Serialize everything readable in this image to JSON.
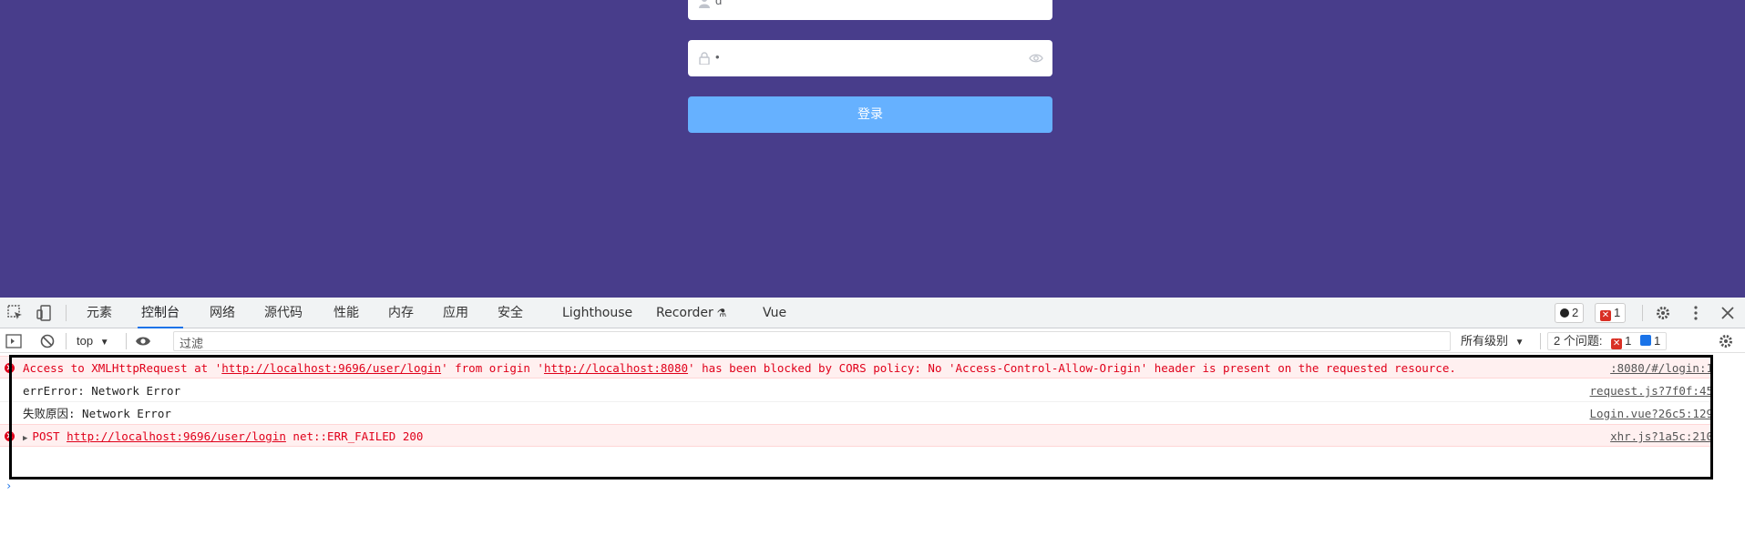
{
  "login": {
    "username_value": "d",
    "password_value": "•",
    "login_button": "登录"
  },
  "devtools": {
    "tabs": [
      {
        "label": "元素"
      },
      {
        "label": "控制台",
        "active": true
      },
      {
        "label": "网络"
      },
      {
        "label": "源代码"
      },
      {
        "label": "性能"
      },
      {
        "label": "内存"
      },
      {
        "label": "应用"
      },
      {
        "label": "安全"
      },
      {
        "label": "Lighthouse"
      },
      {
        "label": "Recorder"
      },
      {
        "label": "Vue"
      }
    ],
    "badges": {
      "messages": "2",
      "errors": "1"
    },
    "filterbar": {
      "context": "top",
      "filter_placeholder": "过滤",
      "levels": "所有级别",
      "issues_label": "2 个问题:",
      "issues_errors": "1",
      "issues_info": "1"
    },
    "console": [
      {
        "type": "error",
        "parts": [
          {
            "text": "Access to XMLHttpRequest at '"
          },
          {
            "text": "http://localhost:9696/user/login",
            "link": true
          },
          {
            "text": "' from origin '"
          },
          {
            "text": "http://localhost:8080",
            "link": true
          },
          {
            "text": "' has been blocked by CORS policy: No 'Access-Control-Allow-Origin' header is present on the requested resource."
          }
        ],
        "source": ":8080/#/login:1"
      },
      {
        "type": "log",
        "text": "errError: Network Error",
        "source": "request.js?7f0f:45"
      },
      {
        "type": "log",
        "text": "失败原因: Network Error",
        "source": "Login.vue?26c5:129"
      },
      {
        "type": "error",
        "parts": [
          {
            "text": "POST "
          },
          {
            "text": "http://localhost:9696/user/login",
            "link": true
          },
          {
            "text": " net::ERR_FAILED 200"
          }
        ],
        "source": "xhr.js?1a5c:210"
      }
    ],
    "colors": {
      "accent": "#1a73e8",
      "error": "#e0001a",
      "page_bg": "#483d8b",
      "button": "#66b1ff"
    }
  }
}
